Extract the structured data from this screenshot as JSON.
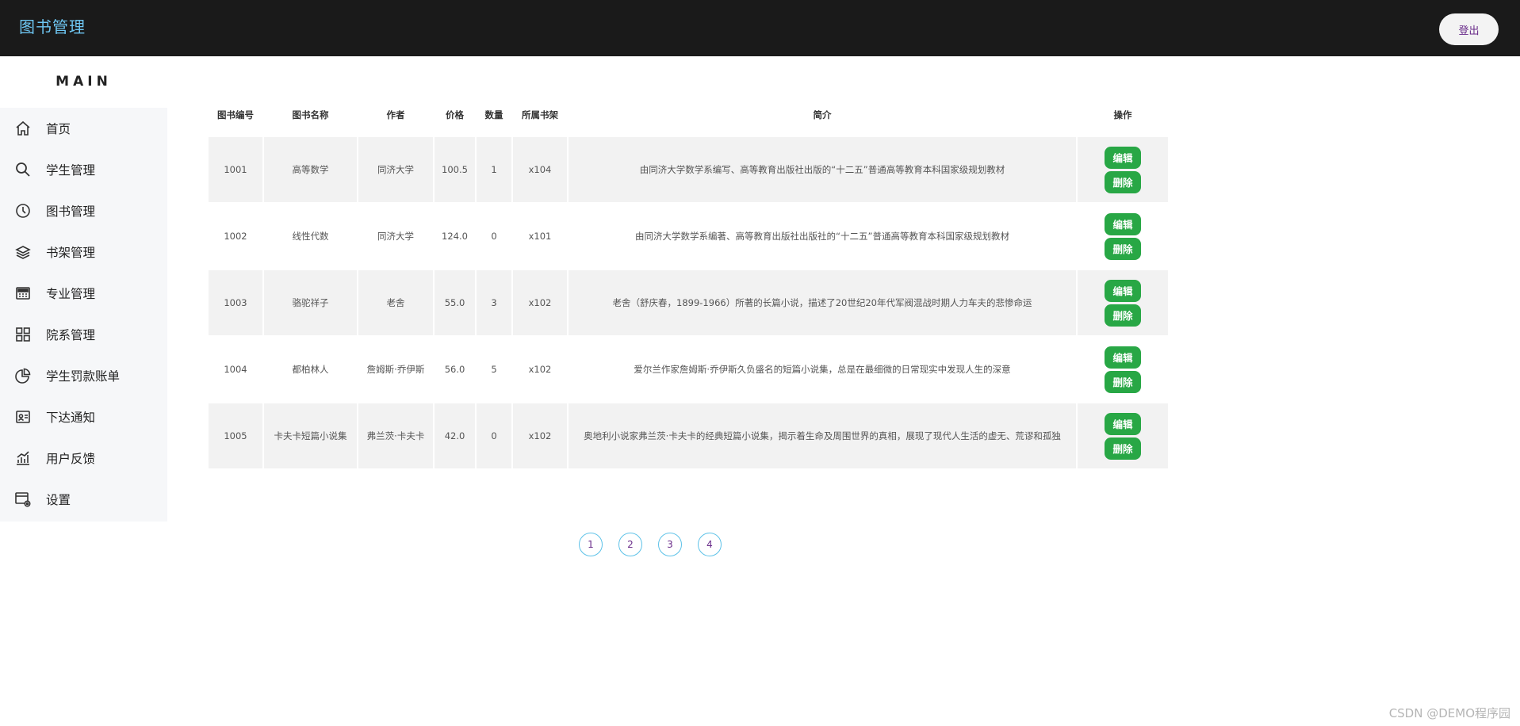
{
  "header": {
    "brand": "图书管理",
    "logout_label": "登出"
  },
  "sidebar": {
    "title": "MAIN",
    "items": [
      {
        "label": "首页",
        "icon": "home-icon"
      },
      {
        "label": "学生管理",
        "icon": "search-icon"
      },
      {
        "label": "图书管理",
        "icon": "clock-icon"
      },
      {
        "label": "书架管理",
        "icon": "layers-icon"
      },
      {
        "label": "专业管理",
        "icon": "calculator-icon"
      },
      {
        "label": "院系管理",
        "icon": "grid-icon"
      },
      {
        "label": "学生罚款账单",
        "icon": "pie-chart-icon"
      },
      {
        "label": "下达通知",
        "icon": "id-card-icon"
      },
      {
        "label": "用户反馈",
        "icon": "bar-chart-icon"
      },
      {
        "label": "设置",
        "icon": "settings-window-icon"
      }
    ]
  },
  "table": {
    "headers": [
      "图书编号",
      "图书名称",
      "作者",
      "价格",
      "数量",
      "所属书架",
      "简介",
      "操作"
    ],
    "rows": [
      {
        "id": "1001",
        "name": "高等数学",
        "author": "同济大学",
        "price": "100.5",
        "qty": "1",
        "shelf": "x104",
        "desc": "由同济大学数学系编写、高等教育出版社出版的“十二五”普通高等教育本科国家级规划教材"
      },
      {
        "id": "1002",
        "name": "线性代数",
        "author": "同济大学",
        "price": "124.0",
        "qty": "0",
        "shelf": "x101",
        "desc": "由同济大学数学系编著、高等教育出版社出版社的“十二五”普通高等教育本科国家级规划教材"
      },
      {
        "id": "1003",
        "name": "骆驼祥子",
        "author": "老舍",
        "price": "55.0",
        "qty": "3",
        "shelf": "x102",
        "desc": "老舍（舒庆春，1899-1966）所著的长篇小说，描述了20世纪20年代军阀混战时期人力车夫的悲惨命运"
      },
      {
        "id": "1004",
        "name": "都柏林人",
        "author": "詹姆斯·乔伊斯",
        "price": "56.0",
        "qty": "5",
        "shelf": "x102",
        "desc": "爱尔兰作家詹姆斯·乔伊斯久负盛名的短篇小说集，总是在最细微的日常现实中发现人生的深意"
      },
      {
        "id": "1005",
        "name": "卡夫卡短篇小说集",
        "author": "弗兰茨·卡夫卡",
        "price": "42.0",
        "qty": "0",
        "shelf": "x102",
        "desc": "奥地利小说家弗兰茨·卡夫卡的经典短篇小说集，揭示着生命及周围世界的真相，展现了现代人生活的虚无、荒谬和孤独"
      }
    ],
    "edit_label": "编辑",
    "delete_label": "删除"
  },
  "pagination": {
    "pages": [
      "1",
      "2",
      "3",
      "4"
    ]
  },
  "watermark": "CSDN @DEMO程序园",
  "colors": {
    "topbar": "#1a1a1a",
    "brand": "#6ec6f2",
    "action_button": "#28a745",
    "pager_border": "#5ec2e8",
    "pager_text": "#6a2c8a"
  }
}
